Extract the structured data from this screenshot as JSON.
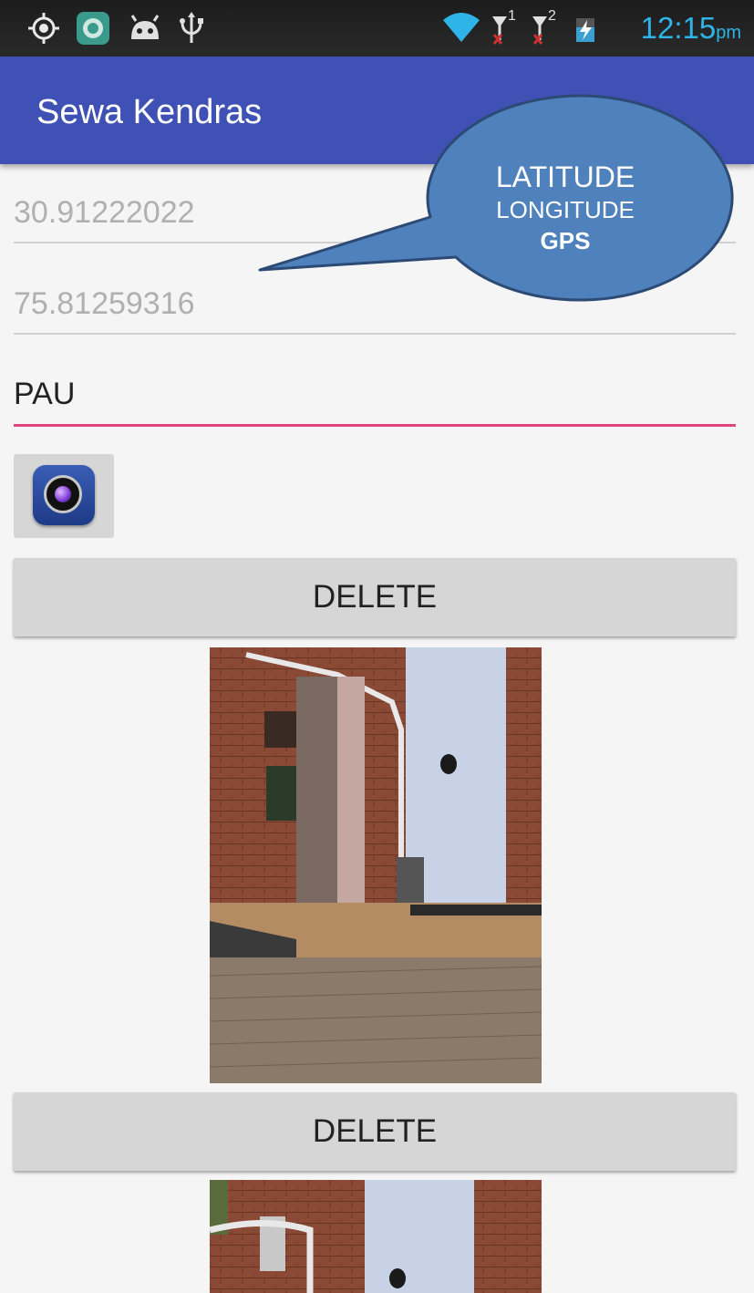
{
  "status_bar": {
    "icons": [
      "gps-icon",
      "app-notification-icon",
      "android-debug-icon",
      "usb-icon",
      "wifi-icon",
      "sim1-no-signal-icon",
      "sim2-no-signal-icon",
      "battery-charging-icon"
    ],
    "sim1_label": "1",
    "sim2_label": "2",
    "time": "12:15",
    "ampm": "pm",
    "time_color": "#2fb4e9"
  },
  "app_bar": {
    "title": "Sewa Kendras",
    "color": "#3f51b5"
  },
  "form": {
    "latitude_value": "30.91222022",
    "longitude_value": "75.81259316",
    "location_name_value": "PAU",
    "camera_icon": "camera-icon",
    "accent_color": "#e0457b"
  },
  "entries": [
    {
      "delete_label": "DELETE"
    },
    {
      "delete_label": "DELETE"
    }
  ],
  "callout": {
    "line1": "LATITUDE",
    "line2": "LONGITUDE",
    "line3": "GPS",
    "fill_color": "#4f81bd",
    "border_color": "#2c4a74"
  }
}
